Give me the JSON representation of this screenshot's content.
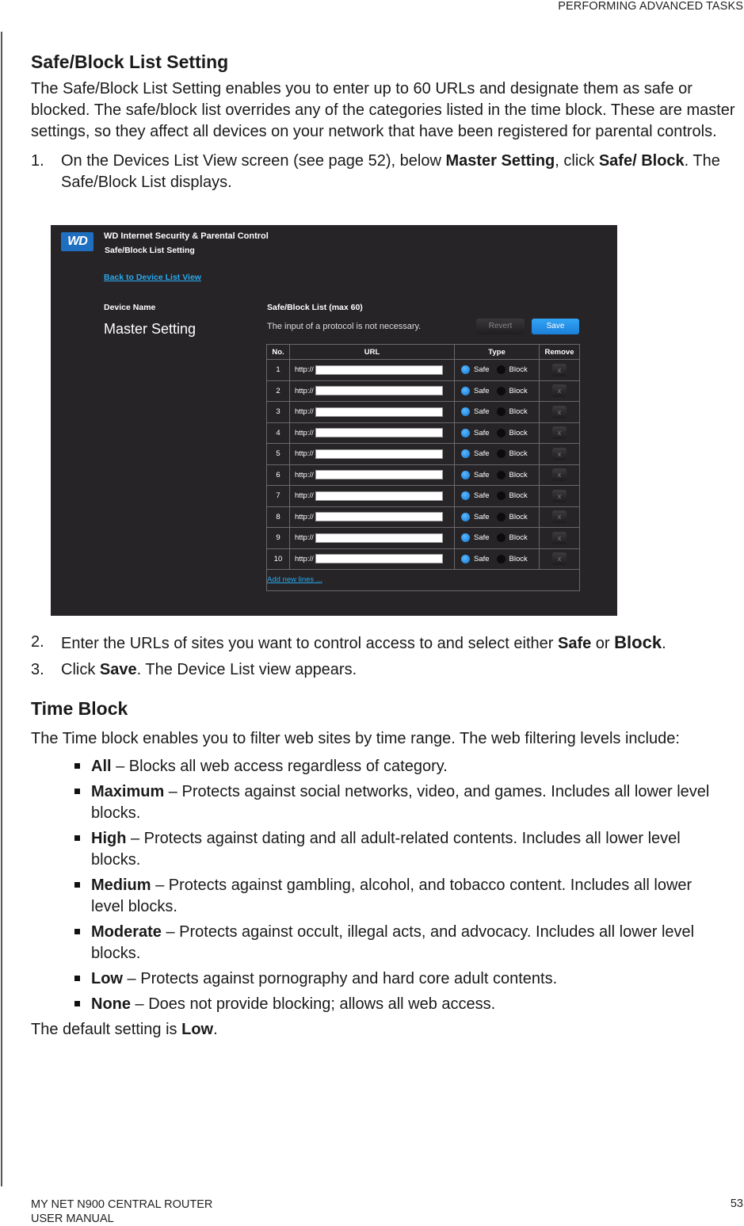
{
  "running_head": "PERFORMING ADVANCED TASKS",
  "section1": {
    "title": "Safe/Block List Setting",
    "intro": "The Safe/Block List Setting enables you to enter up to 60 URLs and designate them as safe or blocked. The safe/block list overrides any of the categories listed in the time block. These are master settings, so they affect all devices on your network that have been registered for parental controls.",
    "step1": {
      "num": "1.",
      "pre": "On the Devices List View screen (see page 52), below ",
      "bold1": "Master Setting",
      "mid": ", click ",
      "bold2": "Safe/ Block",
      "post": ". The Safe/Block List displays."
    },
    "step2": {
      "num": "2.",
      "pre": "Enter the URLs of sites you want to control access to and select either ",
      "bold1": "Safe",
      "mid": " or ",
      "bold2": "Block",
      "post": "."
    },
    "step3": {
      "num": "3.",
      "pre": "Click ",
      "bold1": "Save",
      "post": ". The Device List view appears."
    }
  },
  "screenshot": {
    "logo": "WD",
    "app_title": "WD Internet Security & Parental Control",
    "page_title": "Safe/Block List Setting",
    "back_link": "Back to Device List View",
    "device_name_label": "Device Name",
    "device_name": "Master Setting",
    "list_label": "Safe/Block List (max 60)",
    "hint": "The input of a protocol is not necessary.",
    "revert_label": "Revert",
    "save_label": "Save",
    "columns": [
      "No.",
      "URL",
      "Type",
      "Remove"
    ],
    "protocol_prefix": "http://",
    "safe_label": "Safe",
    "block_label": "Block",
    "remove_label": "x",
    "rows": [
      {
        "no": "1",
        "url": "",
        "type": "Safe"
      },
      {
        "no": "2",
        "url": "",
        "type": "Safe"
      },
      {
        "no": "3",
        "url": "",
        "type": "Safe"
      },
      {
        "no": "4",
        "url": "",
        "type": "Safe"
      },
      {
        "no": "5",
        "url": "",
        "type": "Safe"
      },
      {
        "no": "6",
        "url": "",
        "type": "Safe"
      },
      {
        "no": "7",
        "url": "",
        "type": "Safe"
      },
      {
        "no": "8",
        "url": "",
        "type": "Safe"
      },
      {
        "no": "9",
        "url": "",
        "type": "Safe"
      },
      {
        "no": "10",
        "url": "",
        "type": "Safe"
      }
    ],
    "add_lines": "Add new lines ..."
  },
  "section2": {
    "title": "Time Block",
    "intro": "The Time block enables you to filter web sites by time range. The web filtering levels include:",
    "levels": [
      {
        "name": "All",
        "desc": " – Blocks all web access regardless of category."
      },
      {
        "name": "Maximum",
        "desc": " – Protects against social networks, video, and games. Includes all lower level blocks."
      },
      {
        "name": "High",
        "desc": " – Protects against dating and all adult-related contents. Includes all lower level blocks."
      },
      {
        "name": "Medium",
        "desc": " – Protects against gambling, alcohol, and tobacco content. Includes all lower level blocks."
      },
      {
        "name": "Moderate",
        "desc": " – Protects against occult, illegal acts, and advocacy. Includes all lower level blocks."
      },
      {
        "name": "Low",
        "desc": " – Protects against pornography and hard core adult contents."
      },
      {
        "name": "None",
        "desc": " – Does not provide blocking; allows all web access."
      }
    ],
    "default_pre": "The default setting is ",
    "default_value": "Low",
    "default_post": "."
  },
  "footer": {
    "product": "MY NET N900 CENTRAL ROUTER",
    "doc": "USER MANUAL",
    "page": "53"
  }
}
